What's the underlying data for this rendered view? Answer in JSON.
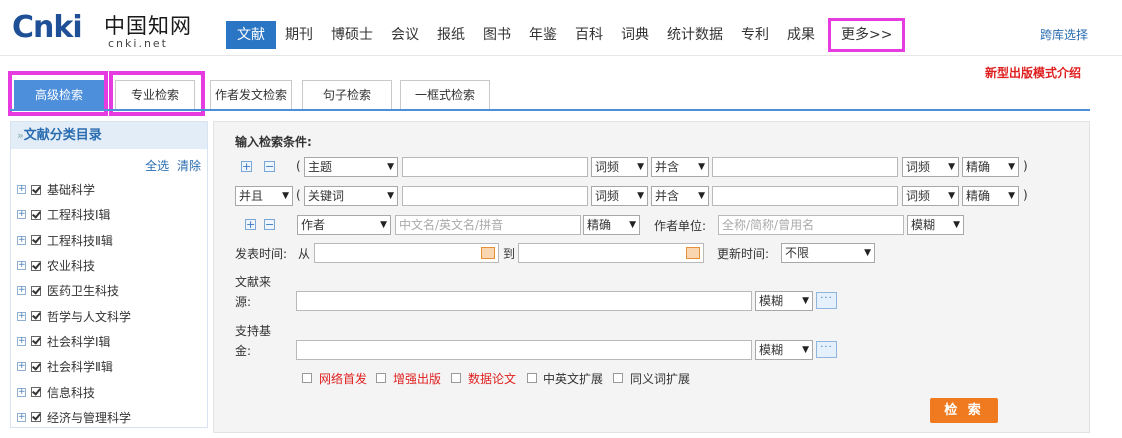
{
  "logo": {
    "brand": "Cnki",
    "chinese": "中国知网",
    "url": "cnki.net"
  },
  "nav": {
    "items": [
      "文献",
      "期刊",
      "博硕士",
      "会议",
      "报纸",
      "图书",
      "年鉴",
      "百科",
      "词典",
      "统计数据",
      "专利",
      "成果"
    ],
    "more": "更多>>",
    "cross_db": "跨库选择"
  },
  "tabs": [
    "高级检索",
    "专业检索",
    "作者发文检索",
    "句子检索",
    "一框式检索"
  ],
  "new_mode_link": "新型出版模式介绍",
  "sidebar": {
    "title_prefix": "»",
    "title": "文献分类目录",
    "select_all": "全选",
    "clear": "清除",
    "items": [
      "基础科学",
      "工程科技Ⅰ辑",
      "工程科技Ⅱ辑",
      "农业科技",
      "医药卫生科技",
      "哲学与人文科学",
      "社会科学Ⅰ辑",
      "社会科学Ⅱ辑",
      "信息科技",
      "经济与管理科学"
    ]
  },
  "form": {
    "heading": "输入检索条件:",
    "row1": {
      "paren_open": "(",
      "field": "主题",
      "freq1": "词频",
      "logic": "并含",
      "freq2": "词频",
      "match": "精确",
      "paren_close": ")"
    },
    "row2": {
      "bool": "并且",
      "paren_open": "(",
      "field": "关键词",
      "freq1": "词频",
      "logic": "并含",
      "freq2": "词频",
      "match": "精确",
      "paren_close": ")"
    },
    "row3": {
      "field": "作者",
      "author_placeholder": "中文名/英文名/拼音",
      "author_match": "精确",
      "unit_label": "作者单位:",
      "unit_placeholder": "全称/简称/曾用名",
      "unit_match": "模糊"
    },
    "date": {
      "label": "发表时间:",
      "from": "从",
      "to": "到",
      "update_label": "更新时间:",
      "update_value": "不限"
    },
    "source": {
      "label_line1": "文献来",
      "label_line2": "源:",
      "match": "模糊",
      "dots": "···"
    },
    "fund": {
      "label_line1": "支持基",
      "label_line2": "金:",
      "match": "模糊",
      "dots": "···"
    },
    "options": [
      "网络首发",
      "增强出版",
      "数据论文",
      "中英文扩展",
      "同义词扩展"
    ],
    "search_button": "检 索"
  },
  "colors": {
    "primary": "#2a75c4",
    "highlight": "#e53be0",
    "search_button": "#ef7a1f",
    "link_red": "#e02020"
  }
}
